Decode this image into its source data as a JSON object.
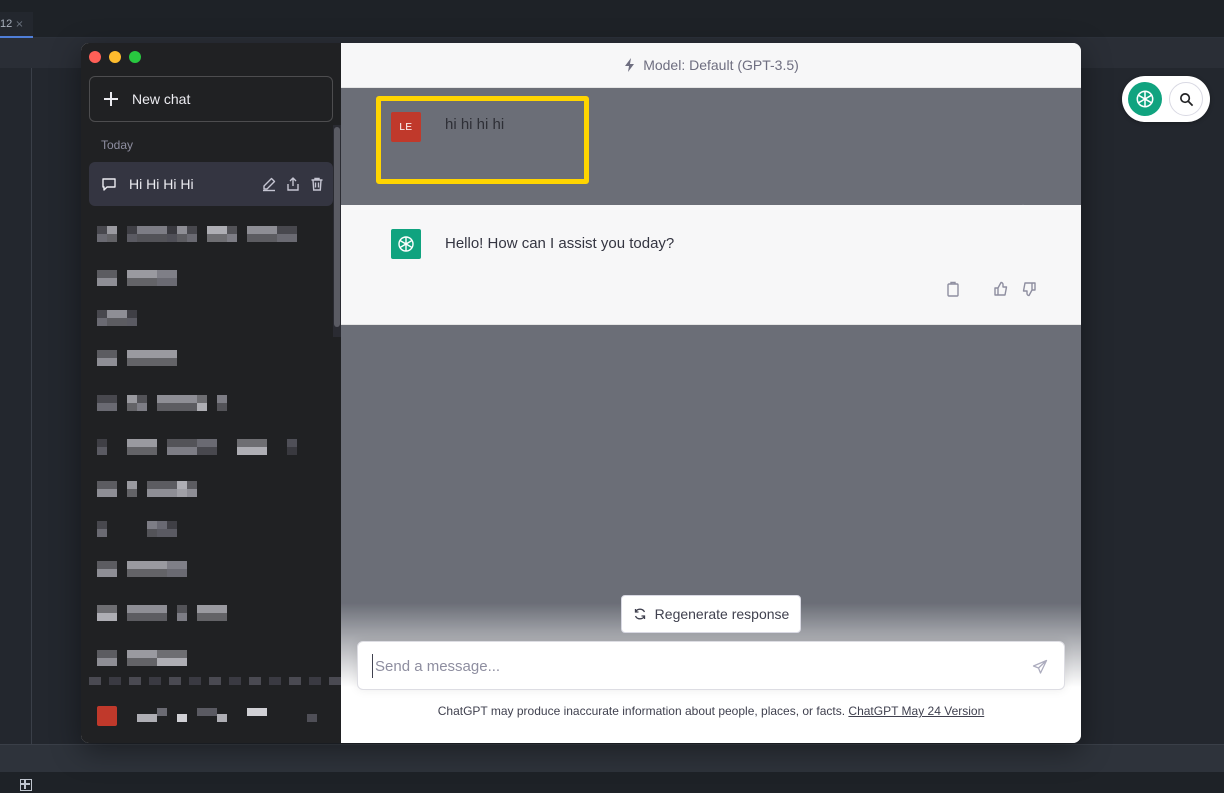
{
  "ide": {
    "tab_label": "12",
    "tab_close": "×"
  },
  "sidebar": {
    "new_chat_label": "New chat",
    "section_today": "Today",
    "active_chat_title": "Hi Hi Hi Hi"
  },
  "main": {
    "model_label": "Model: Default (GPT-3.5)",
    "user_avatar_initials": "LE",
    "user_message": "hi hi hi hi",
    "assistant_message": "Hello! How can I assist you today?",
    "regenerate_label": "Regenerate response",
    "input_placeholder": "Send a message...",
    "disclaimer_text": "ChatGPT may produce inaccurate information about people, places, or facts. ",
    "disclaimer_link": "ChatGPT May 24 Version"
  },
  "colors": {
    "sidebar_bg": "#202123",
    "active_chat_bg": "#343541",
    "gpt_green": "#10a37f",
    "user_avatar": "#c0392b",
    "highlight": "#ffd500"
  },
  "icons": {
    "model": "bolt-icon",
    "chat": "chat-bubble-icon",
    "edit": "pencil-icon",
    "share": "share-icon",
    "delete": "trash-icon",
    "copy": "clipboard-icon",
    "like": "thumbs-up-icon",
    "dislike": "thumbs-down-icon",
    "regenerate": "refresh-icon",
    "send": "send-icon",
    "search": "search-icon"
  }
}
